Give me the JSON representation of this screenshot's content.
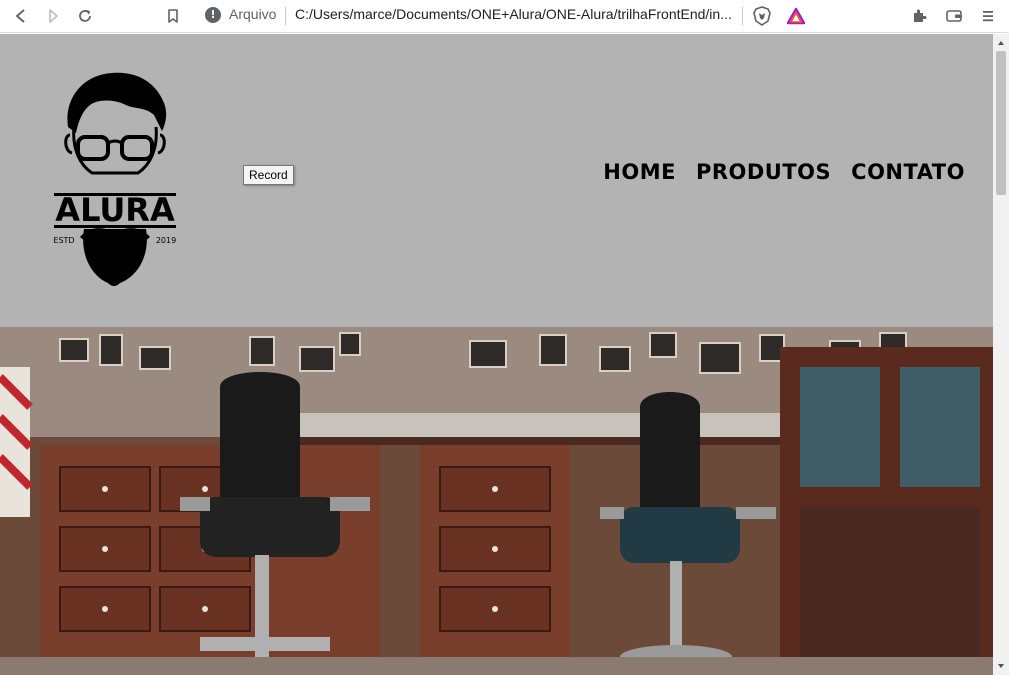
{
  "browser": {
    "address_label": "Arquivo",
    "address_url": "C:/Users/marce/Documents/ONE+Alura/ONE-Alura/trilhaFrontEnd/in..."
  },
  "site": {
    "logo_text": "ALURA",
    "logo_estd": "ESTD",
    "logo_year": "2019",
    "tooltip": "Record",
    "nav": [
      "HOME",
      "PRODUTOS",
      "CONTATO"
    ],
    "header_bg": "#b3b3b3"
  }
}
